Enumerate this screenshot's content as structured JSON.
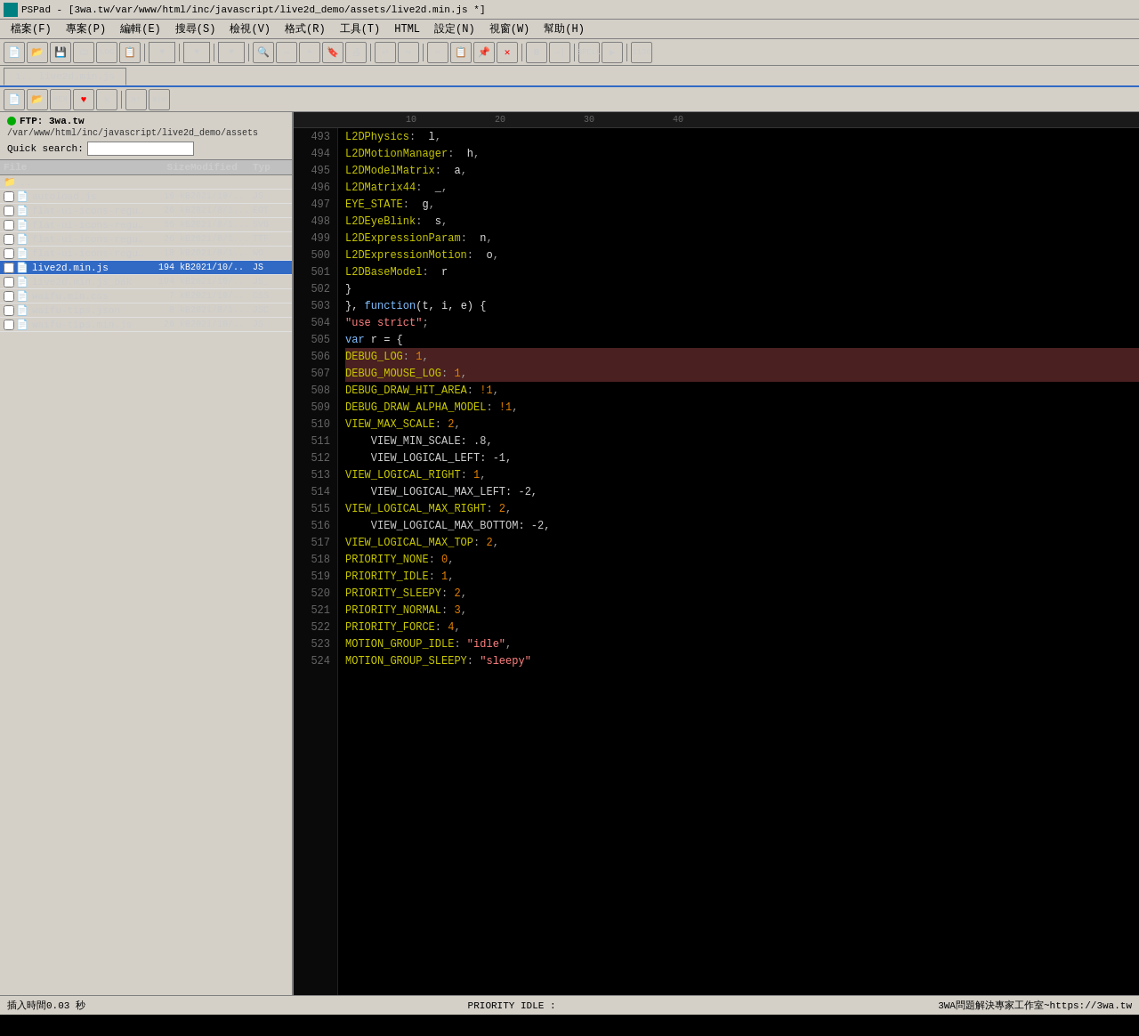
{
  "titleBar": {
    "label": "PSPad - [3wa.tw/var/www/html/inc/javascript/live2d_demo/assets/live2d.min.js *]"
  },
  "menuBar": {
    "items": [
      "檔案(F)",
      "專案(P)",
      "編輯(E)",
      "搜尋(S)",
      "檢視(V)",
      "格式(R)",
      "工具(T)",
      "HTML",
      "設定(N)",
      "視窗(W)",
      "幫助(H)"
    ]
  },
  "tabs": {
    "items": [
      "1.. live2d.min.js"
    ]
  },
  "ftp": {
    "server": "FTP: 3wa.tw",
    "path": "/var/www/html/inc/javascript/live2d_demo/assets",
    "searchLabel": "Quick search:"
  },
  "fileList": {
    "headers": [
      "File",
      "Size",
      "Modified",
      "Typ"
    ],
    "items": [
      {
        "name": "..",
        "size": "",
        "modified": "",
        "type": "",
        "isFolder": true,
        "checked": false
      },
      {
        "name": "autoload.js",
        "size": "16 kB",
        "modified": "2021/10/..",
        "type": "JS",
        "isFolder": false,
        "checked": false
      },
      {
        "name": "flat-ui-icons-regula...",
        "size": "26 kB",
        "modified": "2021/8/1...",
        "type": "EOT",
        "isFolder": false,
        "checked": false
      },
      {
        "name": "flat-ui-icons-regula...",
        "size": "56 kB",
        "modified": "2021/8/1...",
        "type": "SVG",
        "isFolder": false,
        "checked": false
      },
      {
        "name": "flat-ui-icons-regula...",
        "size": "26 kB",
        "modified": "2021/8/1...",
        "type": "TTF",
        "isFolder": false,
        "checked": false
      },
      {
        "name": "flat-ui-icons-regula...",
        "size": "18 kB",
        "modified": "2021/8/1...",
        "type": "WO",
        "isFolder": false,
        "checked": false
      },
      {
        "name": "live2d.min.js",
        "size": "194 kB",
        "modified": "2021/10/..",
        "type": "JS",
        "isFolder": false,
        "checked": false,
        "active": true
      },
      {
        "name": "live2d.min.js_bak",
        "size": "194 kB",
        "modified": "2021/10/..",
        "type": "JS_",
        "isFolder": false,
        "checked": false
      },
      {
        "name": "waifu.min.css",
        "size": "7 kB",
        "modified": "2021/10/..",
        "type": "CSS",
        "isFolder": false,
        "checked": false
      },
      {
        "name": "waifu-tips.json",
        "size": "8 kB",
        "modified": "2021/8/1...",
        "type": "JSC",
        "isFolder": false,
        "checked": false
      },
      {
        "name": "waifu-tips.min.js",
        "size": "26 kB",
        "modified": "2021/10/..",
        "type": "JS",
        "isFolder": false,
        "checked": false
      }
    ]
  },
  "codeLines": [
    {
      "num": 493,
      "highlighted": false,
      "content": "    L2DPhysics: l,"
    },
    {
      "num": 494,
      "highlighted": false,
      "content": "    L2DMotionManager: h,"
    },
    {
      "num": 495,
      "highlighted": false,
      "content": "    L2DModelMatrix: a,"
    },
    {
      "num": 496,
      "highlighted": false,
      "content": "    L2DMatrix44: _,"
    },
    {
      "num": 497,
      "highlighted": false,
      "content": "    EYE_STATE: g,"
    },
    {
      "num": 498,
      "highlighted": false,
      "content": "    L2DEyeBlink: s,"
    },
    {
      "num": 499,
      "highlighted": false,
      "content": "    L2DExpressionParam: n,"
    },
    {
      "num": 500,
      "highlighted": false,
      "content": "    L2DExpressionMotion: o,"
    },
    {
      "num": 501,
      "highlighted": false,
      "content": "    L2DBaseModel: r"
    },
    {
      "num": 502,
      "highlighted": false,
      "content": "  }"
    },
    {
      "num": 503,
      "highlighted": false,
      "content": "}, function(t, i, e) {"
    },
    {
      "num": 504,
      "highlighted": false,
      "content": "  \"use strict\";"
    },
    {
      "num": 505,
      "highlighted": false,
      "content": "  var r = {"
    },
    {
      "num": 506,
      "highlighted": true,
      "content": "    DEBUG_LOG: 1,"
    },
    {
      "num": 507,
      "highlighted": true,
      "content": "    DEBUG_MOUSE_LOG: 1,"
    },
    {
      "num": 508,
      "highlighted": false,
      "content": "    DEBUG_DRAW_HIT_AREA: !1,"
    },
    {
      "num": 509,
      "highlighted": false,
      "content": "    DEBUG_DRAW_ALPHA_MODEL: !1,"
    },
    {
      "num": 510,
      "highlighted": false,
      "content": "    VIEW_MAX_SCALE: 2,"
    },
    {
      "num": 511,
      "highlighted": false,
      "content": "    VIEW_MIN_SCALE: .8,"
    },
    {
      "num": 512,
      "highlighted": false,
      "content": "    VIEW_LOGICAL_LEFT: -1,"
    },
    {
      "num": 513,
      "highlighted": false,
      "content": "    VIEW_LOGICAL_RIGHT: 1,"
    },
    {
      "num": 514,
      "highlighted": false,
      "content": "    VIEW_LOGICAL_MAX_LEFT: -2,"
    },
    {
      "num": 515,
      "highlighted": false,
      "content": "    VIEW_LOGICAL_MAX_RIGHT: 2,"
    },
    {
      "num": 516,
      "highlighted": false,
      "content": "    VIEW_LOGICAL_MAX_BOTTOM: -2,"
    },
    {
      "num": 517,
      "highlighted": false,
      "content": "    VIEW_LOGICAL_MAX_TOP: 2,"
    },
    {
      "num": 518,
      "highlighted": false,
      "content": "    PRIORITY_NONE: 0,"
    },
    {
      "num": 519,
      "highlighted": false,
      "content": "    PRIORITY_IDLE: 1,"
    },
    {
      "num": 520,
      "highlighted": false,
      "content": "    PRIORITY_SLEEPY: 2,"
    },
    {
      "num": 521,
      "highlighted": false,
      "content": "    PRIORITY_NORMAL: 3,"
    },
    {
      "num": 522,
      "highlighted": false,
      "content": "    PRIORITY_FORCE: 4,"
    },
    {
      "num": 523,
      "highlighted": false,
      "content": "    MOTION_GROUP_IDLE: \"idle\","
    },
    {
      "num": 524,
      "highlighted": false,
      "content": "    MOTION_GROUP_SLEEPY: \"sleepy\""
    }
  ],
  "ruler": {
    "marks": [
      "10",
      "20",
      "30",
      "40"
    ]
  },
  "statusBar": {
    "left": "插入時間0.03 秒",
    "right": "3WA問題解決專家工作室~https://3wa.tw",
    "center": "PRIORITY IDLE :"
  }
}
